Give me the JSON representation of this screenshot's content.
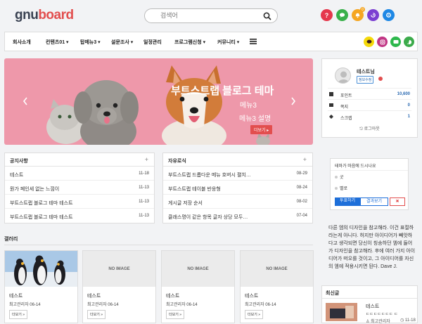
{
  "header": {
    "logo_main": "gnu",
    "logo_accent": "board",
    "search_placeholder": "검색어",
    "notif_count": "0",
    "colors": {
      "q": "#e5374c",
      "chat": "#38b04a",
      "bell": "#f5a623",
      "history": "#7b3fd1",
      "settings": "#1e88e5"
    }
  },
  "nav": {
    "items": [
      "회사소개",
      "컨텐츠01",
      "탑메뉴3",
      "설문조사",
      "일정관리",
      "프로그램신청",
      "커뮤니티"
    ]
  },
  "banner": {
    "title": "부트스트랩 블로그 테마",
    "sub": "메뉴3",
    "desc": "메뉴3 설명",
    "more": "더보기 ▸"
  },
  "notice": {
    "title": "공지사항",
    "rows": [
      {
        "label": "테스트",
        "date": "11-18"
      },
      {
        "label": "뭔가 페인세 없는 느낌이",
        "date": "11-13"
      },
      {
        "label": "부트스트랩 블로그 테마 테스트",
        "date": "11-13"
      },
      {
        "label": "부트스트랩 블로그 테마 테스트",
        "date": "11-13"
      }
    ]
  },
  "free": {
    "title": "자유로식",
    "rows": [
      {
        "label": "부트스트랩 드롭다운 메뉴 호버시 펼치…",
        "date": "08-29"
      },
      {
        "label": "부트스트랩 테이블 반응형",
        "date": "08-24"
      },
      {
        "label": "게시글 저장 순서",
        "date": "08-02"
      },
      {
        "label": "클래스명이 같은 항목 글자 상당 모두…",
        "date": "07-04"
      }
    ]
  },
  "gallery": {
    "title": "갤러리",
    "cards": [
      {
        "image": "penguins",
        "no_image": "",
        "title": "테스트",
        "meta": "최고관리자 06-14",
        "more": "더보기 »"
      },
      {
        "image": "",
        "no_image": "NO IMAGE",
        "title": "테스트",
        "meta": "최고관리자 06-14",
        "more": "더보기 »"
      },
      {
        "image": "",
        "no_image": "NO IMAGE",
        "title": "테스트",
        "meta": "최고관리자 06-14",
        "more": "더보기 »"
      },
      {
        "image": "",
        "no_image": "NO IMAGE",
        "title": "테스트",
        "meta": "최고관리자 06-14",
        "more": "더보기 »"
      }
    ]
  },
  "profile": {
    "nick": "테스트님",
    "edit": "정보수정",
    "rows": [
      {
        "label": "포인트",
        "value": "10,600"
      },
      {
        "label": "쪽지",
        "value": "0"
      },
      {
        "label": "스크랩",
        "value": "1"
      }
    ],
    "logout": "로그아웃"
  },
  "poll": {
    "question": "테마가 마음에 드시나요",
    "options": [
      "굿",
      "별로"
    ],
    "vote": "투표하기",
    "result": "결과보기",
    "close": "✖"
  },
  "quote": "다른 엠의 디자인을 참고해라. 이건 표절하라는게 아니다. 허지만 아이디어가 빼앗하다고 생각되면 당신이 칭송하던 엠에 들어가 디자인을 참고해라. 후에 여러 가지 아이디어가 떠오를 것이고, 그 아이디어를 자신의 엠에 적용시키면 된다. Dave J.",
  "recent": {
    "title": "최신글",
    "item_title": "테스트",
    "item_sub": "ㄷㄷㄷㄷㄷㄷㄷ ㄷ",
    "item_meta": "최고관리자",
    "item_date": "11-18"
  }
}
